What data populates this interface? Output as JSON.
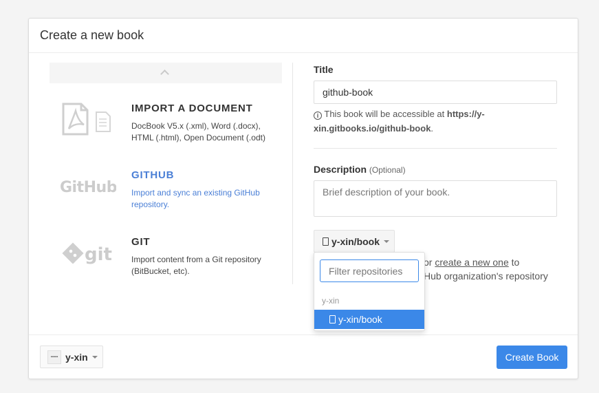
{
  "modal": {
    "title": "Create a new book"
  },
  "options": [
    {
      "title": "IMPORT A DOCUMENT",
      "desc": "DocBook V5.x (.xml), Word (.docx), HTML (.html), Open Document (.odt)",
      "icon": "pdf-doc-icon",
      "active": false
    },
    {
      "title": "GITHUB",
      "desc": "Import and sync an existing GitHub repository.",
      "icon": "github-logo-icon",
      "active": true
    },
    {
      "title": "GIT",
      "desc": "Import content from a Git repository (BitBucket, etc).",
      "icon": "git-logo-icon",
      "active": false
    }
  ],
  "form": {
    "title_label": "Title",
    "title_value": "github-book",
    "help_prefix": "This book will be accessible at",
    "help_url": "https://y-xin.gitbooks.io/github-book",
    "help_suffix": ".",
    "description_label": "Description",
    "description_optional": "(Optional)",
    "description_placeholder": "Brief description of your book.",
    "repo_selected": "y-xin/book",
    "behind_text_line1_prefix": "or",
    "behind_text_link": "create a new one",
    "behind_text_line1_suffix": "to",
    "behind_text_line2": "Hub organization's repository"
  },
  "dropdown": {
    "filter_placeholder": "Filter repositories",
    "group_label": "y-xin",
    "items": [
      "y-xin/book"
    ]
  },
  "footer": {
    "user": "y-xin",
    "avatar_text": "▪▪▪▪▪",
    "create_label": "Create Book"
  },
  "colors": {
    "accent": "#3b88e8",
    "active_link": "#4a7fd6"
  }
}
